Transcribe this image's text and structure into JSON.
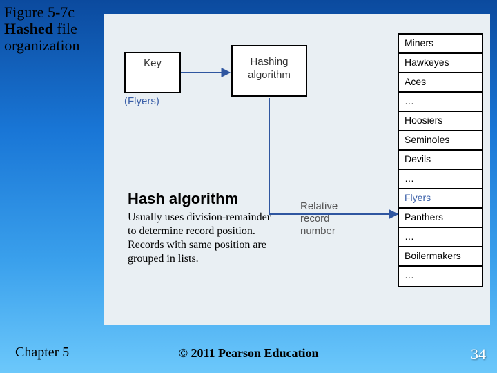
{
  "title": {
    "figure": "Figure 5-7c",
    "bold_word": "Hashed",
    "rest": " file organization"
  },
  "diagram": {
    "key_label": "Key",
    "key_example": "(Flyers)",
    "algo_label": "Hashing algorithm",
    "rel_label": "Relative record number",
    "records": [
      "Miners",
      "Hawkeyes",
      "Aces",
      "…",
      "Hoosiers",
      "Seminoles",
      "Devils",
      "…",
      "Flyers",
      "Panthers",
      "…",
      "Boilermakers",
      "…"
    ],
    "highlight_index": 8
  },
  "note": {
    "heading": "Hash algorithm",
    "body": "Usually uses division-remainder to determine record position. Records with same position are grouped in lists."
  },
  "footer": {
    "chapter": "Chapter 5",
    "copyright": "© 2011 Pearson Education",
    "page": "34"
  }
}
